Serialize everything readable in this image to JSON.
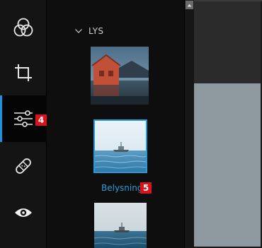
{
  "panel": {
    "section_title": "LYS",
    "selected_preset_label": "Belysning"
  },
  "toolbar": {
    "items": [
      {
        "name": "color-filters",
        "icon": "three-circles-icon"
      },
      {
        "name": "crop",
        "icon": "crop-icon"
      },
      {
        "name": "adjust",
        "icon": "sliders-icon",
        "active": true
      },
      {
        "name": "heal",
        "icon": "bandage-icon"
      },
      {
        "name": "view",
        "icon": "eye-icon"
      }
    ]
  },
  "callouts": {
    "adjust_badge": "4",
    "preset_badge": "5"
  },
  "colors": {
    "accent_blue": "#2a9bd8",
    "active_bar": "#1e90e0",
    "badge_red": "#d9131c",
    "canvas_gray": "#8d999f"
  }
}
